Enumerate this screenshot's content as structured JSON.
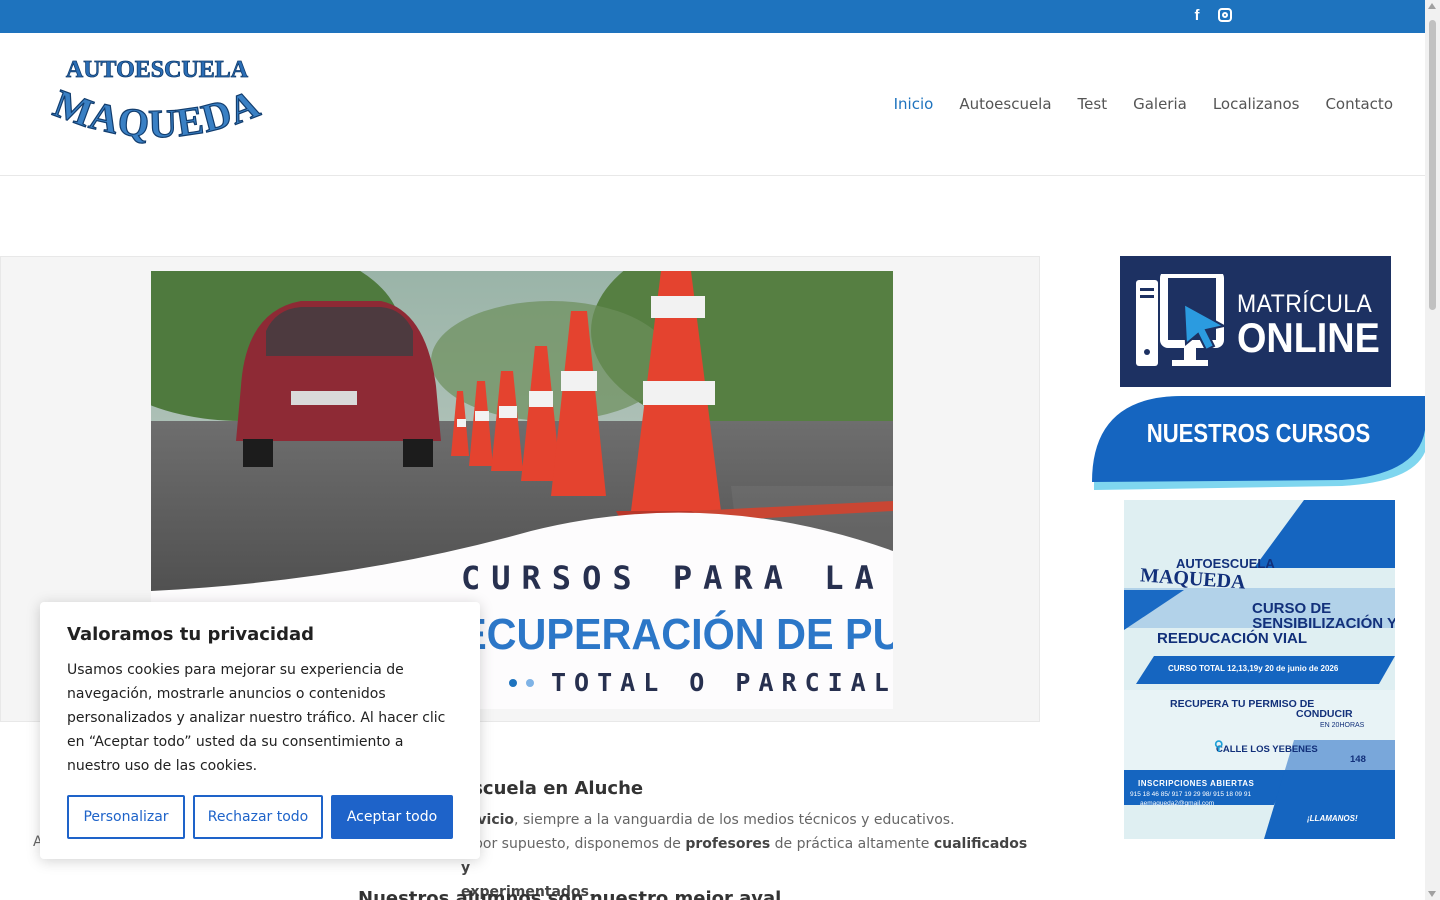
{
  "topbar": {
    "facebook_icon": "facebook-icon",
    "instagram_icon": "instagram-icon",
    "color": "#1e73be"
  },
  "logo": {
    "line1": "AUTOESCUELA",
    "line2": "MAQUEDA"
  },
  "nav": {
    "items": [
      {
        "label": "Inicio",
        "active": true
      },
      {
        "label": "Autoescuela"
      },
      {
        "label": "Test"
      },
      {
        "label": "Galeria"
      },
      {
        "label": "Localizanos"
      },
      {
        "label": "Contacto"
      }
    ],
    "active_color": "#1e73be"
  },
  "slider": {
    "line1": "CURSOS PARA LA",
    "line2": "RECUPERACIÓN DE PUNTOS",
    "line3": "TOTAL O PARCIAL",
    "slide_count": 2,
    "active_slide": 1
  },
  "sidebar": {
    "matricula": {
      "line1": "MATRÍCULA",
      "line2": "ONLINE"
    },
    "cursos": {
      "label": "NUESTROS CURSOS"
    },
    "poster": {
      "brand1": "AUTOESCUELA",
      "brand2": "MAQUEDA",
      "title1": "CURSO DE",
      "title2": "SENSIBILIZACIÓN Y",
      "title3": "REEDUCACIÓN VIAL",
      "dates": "CURSO TOTAL 12,13,19y 20 de junio de 2026",
      "recupera1": "RECUPERA TU PERMISO DE",
      "recupera2": "CONDUCIR",
      "horas": "EN 20HORAS",
      "address1": "CALLE LOS YEBENES",
      "address2": "148",
      "inscripciones": "INSCRIPCIONES ABIERTAS",
      "phones": "915 18 46  85/ 917 19 29 98/ 915 18 09 91",
      "email": "aemaqueda2@gmail.com",
      "llamanos": "¡LLAMANOS!"
    }
  },
  "content": {
    "heading": "escuela en Aluche",
    "p1_bold": "ervicio",
    "p1_rest": ", siempre a la vanguardia de los medios técnicos y educativos.",
    "p2_a": "Y por supuesto, disponemos de ",
    "p2_b": "profesores",
    "p2_c": " de práctica altamente ",
    "p2_d": "cualificados y",
    "p2_e": "experimentados",
    "p2_f": ".",
    "left_fragment": "A",
    "bottom_heading": "Nuestros alumnos son nuestro mejor aval"
  },
  "cookie": {
    "title": "Valoramos tu privacidad",
    "body": "Usamos cookies para mejorar su experiencia de navegación, mostrarle anuncios o contenidos personalizados y analizar nuestro tráfico. Al hacer clic en “Aceptar todo” usted da su consentimiento a nuestro uso de las cookies.",
    "btn_customize": "Personalizar",
    "btn_reject": "Rechazar todo",
    "btn_accept": "Aceptar todo",
    "accent": "#1e63c9"
  }
}
